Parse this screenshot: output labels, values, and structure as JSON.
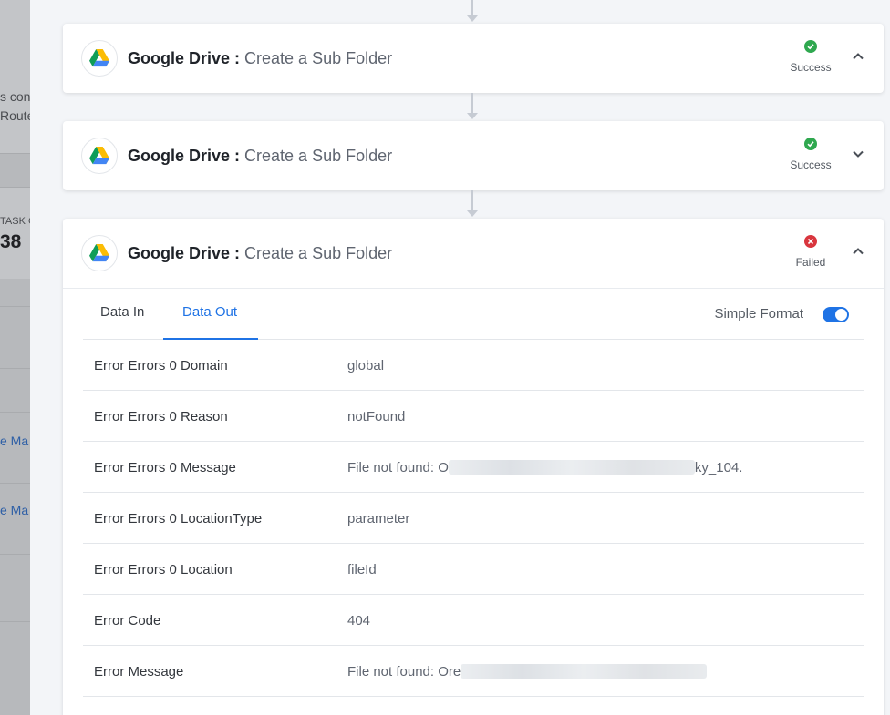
{
  "background": {
    "text1": "s con",
    "text2": "Route",
    "task_label": "TASK C",
    "task_count": "38",
    "link1": "e Ma",
    "link2": "e Ma"
  },
  "steps": [
    {
      "app": "Google Drive",
      "separator": " : ",
      "action": "Create a Sub Folder",
      "status": "Success",
      "expanded": true
    },
    {
      "app": "Google Drive",
      "separator": " : ",
      "action": "Create a Sub Folder",
      "status": "Success",
      "expanded": false
    },
    {
      "app": "Google Drive",
      "separator": " : ",
      "action": "Create a Sub Folder",
      "status": "Failed",
      "expanded": true
    }
  ],
  "tabs": {
    "data_in": "Data In",
    "data_out": "Data Out",
    "active": "data_out"
  },
  "simple_format": {
    "label": "Simple Format",
    "enabled": true
  },
  "rows": [
    {
      "key": "Error Errors 0 Domain",
      "value": "global"
    },
    {
      "key": "Error Errors 0 Reason",
      "value": "notFound"
    },
    {
      "key": "Error Errors 0 Message",
      "value_prefix": "File not found: O",
      "value_suffix": "ky_104."
    },
    {
      "key": "Error Errors 0 LocationType",
      "value": "parameter"
    },
    {
      "key": "Error Errors 0 Location",
      "value": "fileId"
    },
    {
      "key": "Error Code",
      "value": "404"
    },
    {
      "key": "Error Message",
      "value_prefix": "File not found: Ore",
      "value_suffix": ""
    }
  ],
  "colors": {
    "accent": "#1f73e5",
    "success": "#2fa84f",
    "failed": "#d9363e"
  },
  "icons": {
    "app_logo": "google-drive-icon",
    "success": "check-circle-icon",
    "failed": "x-circle-icon"
  }
}
